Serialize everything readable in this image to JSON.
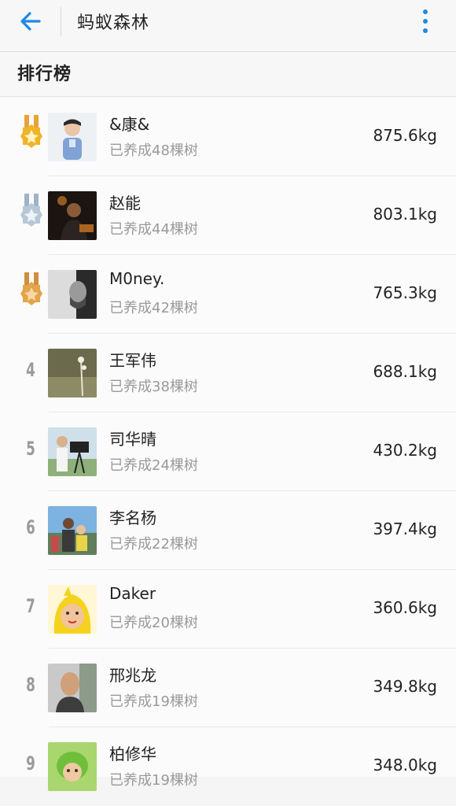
{
  "appbar": {
    "title": "蚂蚁森林",
    "back_icon": "arrow-left-icon",
    "menu_icon": "more-vertical-icon"
  },
  "section": {
    "title": "排行榜"
  },
  "colors": {
    "accent": "#1e88e5",
    "gold": "#f0b429",
    "silver": "#b8c7d6",
    "bronze": "#e3a44a"
  },
  "ranking": [
    {
      "rank": "1",
      "medal": "gold",
      "name": "&康&",
      "trees": "已养成48棵树",
      "weight": "875.6kg"
    },
    {
      "rank": "2",
      "medal": "silver",
      "name": "赵能",
      "trees": "已养成44棵树",
      "weight": "803.1kg"
    },
    {
      "rank": "3",
      "medal": "bronze",
      "name": "M0ney.",
      "trees": "已养成42棵树",
      "weight": "765.3kg"
    },
    {
      "rank": "4",
      "name": "王军伟",
      "trees": "已养成38棵树",
      "weight": "688.1kg"
    },
    {
      "rank": "5",
      "name": "司华晴",
      "trees": "已养成24棵树",
      "weight": "430.2kg"
    },
    {
      "rank": "6",
      "name": "李名杨",
      "trees": "已养成22棵树",
      "weight": "397.4kg"
    },
    {
      "rank": "7",
      "name": "Daker",
      "trees": "已养成20棵树",
      "weight": "360.6kg"
    },
    {
      "rank": "8",
      "name": "邢兆龙",
      "trees": "已养成19棵树",
      "weight": "349.8kg"
    },
    {
      "rank": "9",
      "name": "柏修华",
      "trees": "已养成19棵树",
      "weight": "348.0kg"
    }
  ]
}
